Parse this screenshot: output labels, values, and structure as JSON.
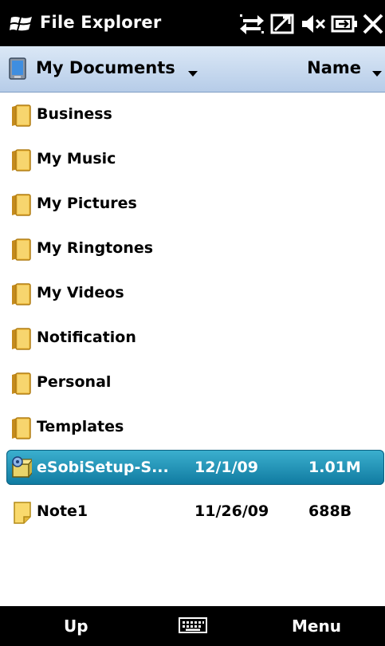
{
  "titlebar": {
    "title": "File Explorer",
    "icons": [
      "windows-logo-icon",
      "connectivity-icon",
      "signal-icon",
      "volume-muted-icon",
      "battery-icon",
      "close-icon"
    ]
  },
  "location": {
    "folder": "My Documents",
    "sort": "Name",
    "folder_icon": "documents-icon"
  },
  "items": [
    {
      "name": "Business",
      "type": "folder"
    },
    {
      "name": "My Music",
      "type": "folder"
    },
    {
      "name": "My Pictures",
      "type": "folder"
    },
    {
      "name": "My Ringtones",
      "type": "folder"
    },
    {
      "name": "My Videos",
      "type": "folder"
    },
    {
      "name": "Notification",
      "type": "folder"
    },
    {
      "name": "Personal",
      "type": "folder"
    },
    {
      "name": "Templates",
      "type": "folder"
    },
    {
      "name": "eSobiSetup-S...",
      "type": "installer",
      "date": "12/1/09",
      "size": "1.01M",
      "selected": true
    },
    {
      "name": "Note1",
      "type": "note",
      "date": "11/26/09",
      "size": "688B"
    }
  ],
  "softkeys": {
    "left": "Up",
    "center_icon": "keyboard-icon",
    "right": "Menu"
  },
  "colors": {
    "selection": "#1a8fb5",
    "header_gradient_top": "#dbe8f6",
    "header_gradient_bottom": "#b6cce8",
    "folder": "#f2c24b"
  }
}
